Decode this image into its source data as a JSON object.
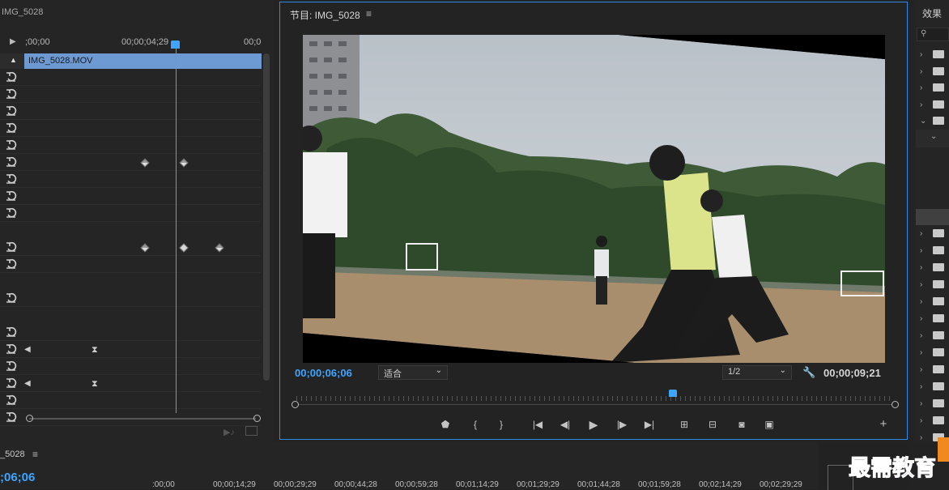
{
  "effect_controls": {
    "source_title": "IMG_5028",
    "ruler": {
      "start": ";00;00",
      "playhead": "00;00;04;29",
      "end": "00;0"
    },
    "clip_name": "IMG_5028.MOV"
  },
  "program_monitor": {
    "title": "节目: IMG_5028",
    "current_time": "00;00;06;06",
    "zoom": "适合",
    "resolution": "1/2",
    "duration": "00;00;09;21",
    "playhead_fraction": 0.63
  },
  "effects_panel": {
    "title": "效果"
  },
  "timeline": {
    "sequence_name": "_5028",
    "current_time": ";06;06",
    "ticks": [
      ":00;00",
      "00;00;14;29",
      "00;00;29;29",
      "00;00;44;28",
      "00;00;59;28",
      "00;01;14;29",
      "00;01;29;29",
      "00;01;44;28",
      "00;01;59;28",
      "00;02;14;29",
      "00;02;29;29"
    ]
  },
  "watermark": "最需教育",
  "colors": {
    "accent": "#2e8ce6",
    "clip": "#6d9ad3",
    "timecode": "#3ea4ff"
  },
  "icons": [
    "reset-icon",
    "menu-icon",
    "wrench-icon",
    "marker-icon",
    "mark-in-icon",
    "mark-out-icon",
    "go-to-in-icon",
    "step-back-icon",
    "play-icon",
    "step-forward-icon",
    "go-to-out-icon",
    "lift-icon",
    "extract-icon",
    "camera-icon",
    "compare-icon",
    "add-icon",
    "search-icon",
    "folder-icon",
    "chevron-right-icon",
    "chevron-down-icon"
  ]
}
